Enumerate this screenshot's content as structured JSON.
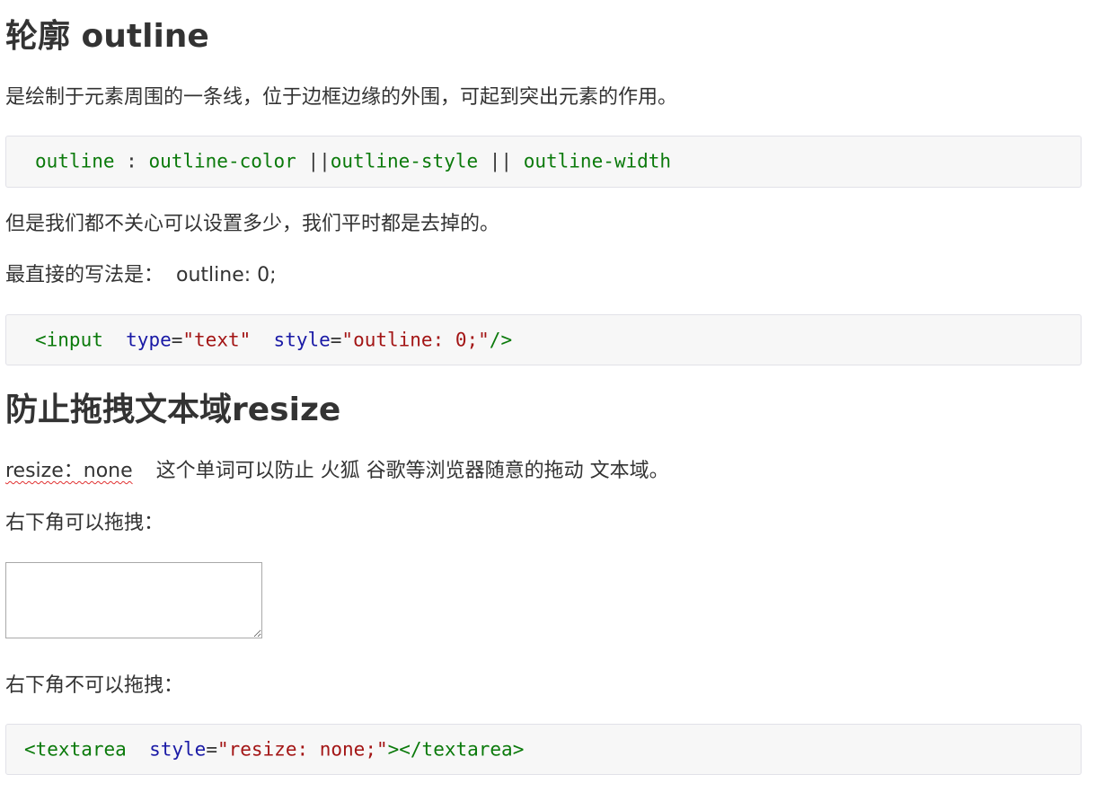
{
  "section1": {
    "heading": "轮廓 outline",
    "description": " 是绘制于元素周围的一条线，位于边框边缘的外围，可起到突出元素的作用。",
    "syntax": {
      "t1": "outline",
      "t2": " : ",
      "t3": "outline-color",
      "t4": " ||",
      "t5": "outline-style",
      "t6": " || ",
      "t7": "outline-width"
    },
    "note": " 但是我们都不关心可以设置多少，我们平时都是去掉的。",
    "simplest_label": "最直接的写法是：",
    "simplest_value": "outline: 0;",
    "example": {
      "open": "<input",
      "attr1": "type",
      "eq1": "=",
      "val1": "\"text\"",
      "attr2": "style",
      "eq2": "=",
      "val2": "\"outline: 0;\"",
      "close": "/>"
    }
  },
  "section2": {
    "heading": "防止拖拽文本域resize",
    "resize_term": "resize：none",
    "resize_desc": "这个单词可以防止 火狐 谷歌等浏览器随意的拖动 文本域。",
    "can_drag": "右下角可以拖拽：",
    "cannot_drag": "右下角不可以拖拽：",
    "example": {
      "open": "<textarea",
      "attr": "style",
      "eq": "=",
      "val": "\"resize: none;\"",
      "close": "></textarea>"
    }
  },
  "colors": {
    "keyword": "#0b7a0b",
    "attribute": "#1a1aa6",
    "string": "#a31515",
    "code_background": "#f7f7f7",
    "text": "#333333"
  }
}
